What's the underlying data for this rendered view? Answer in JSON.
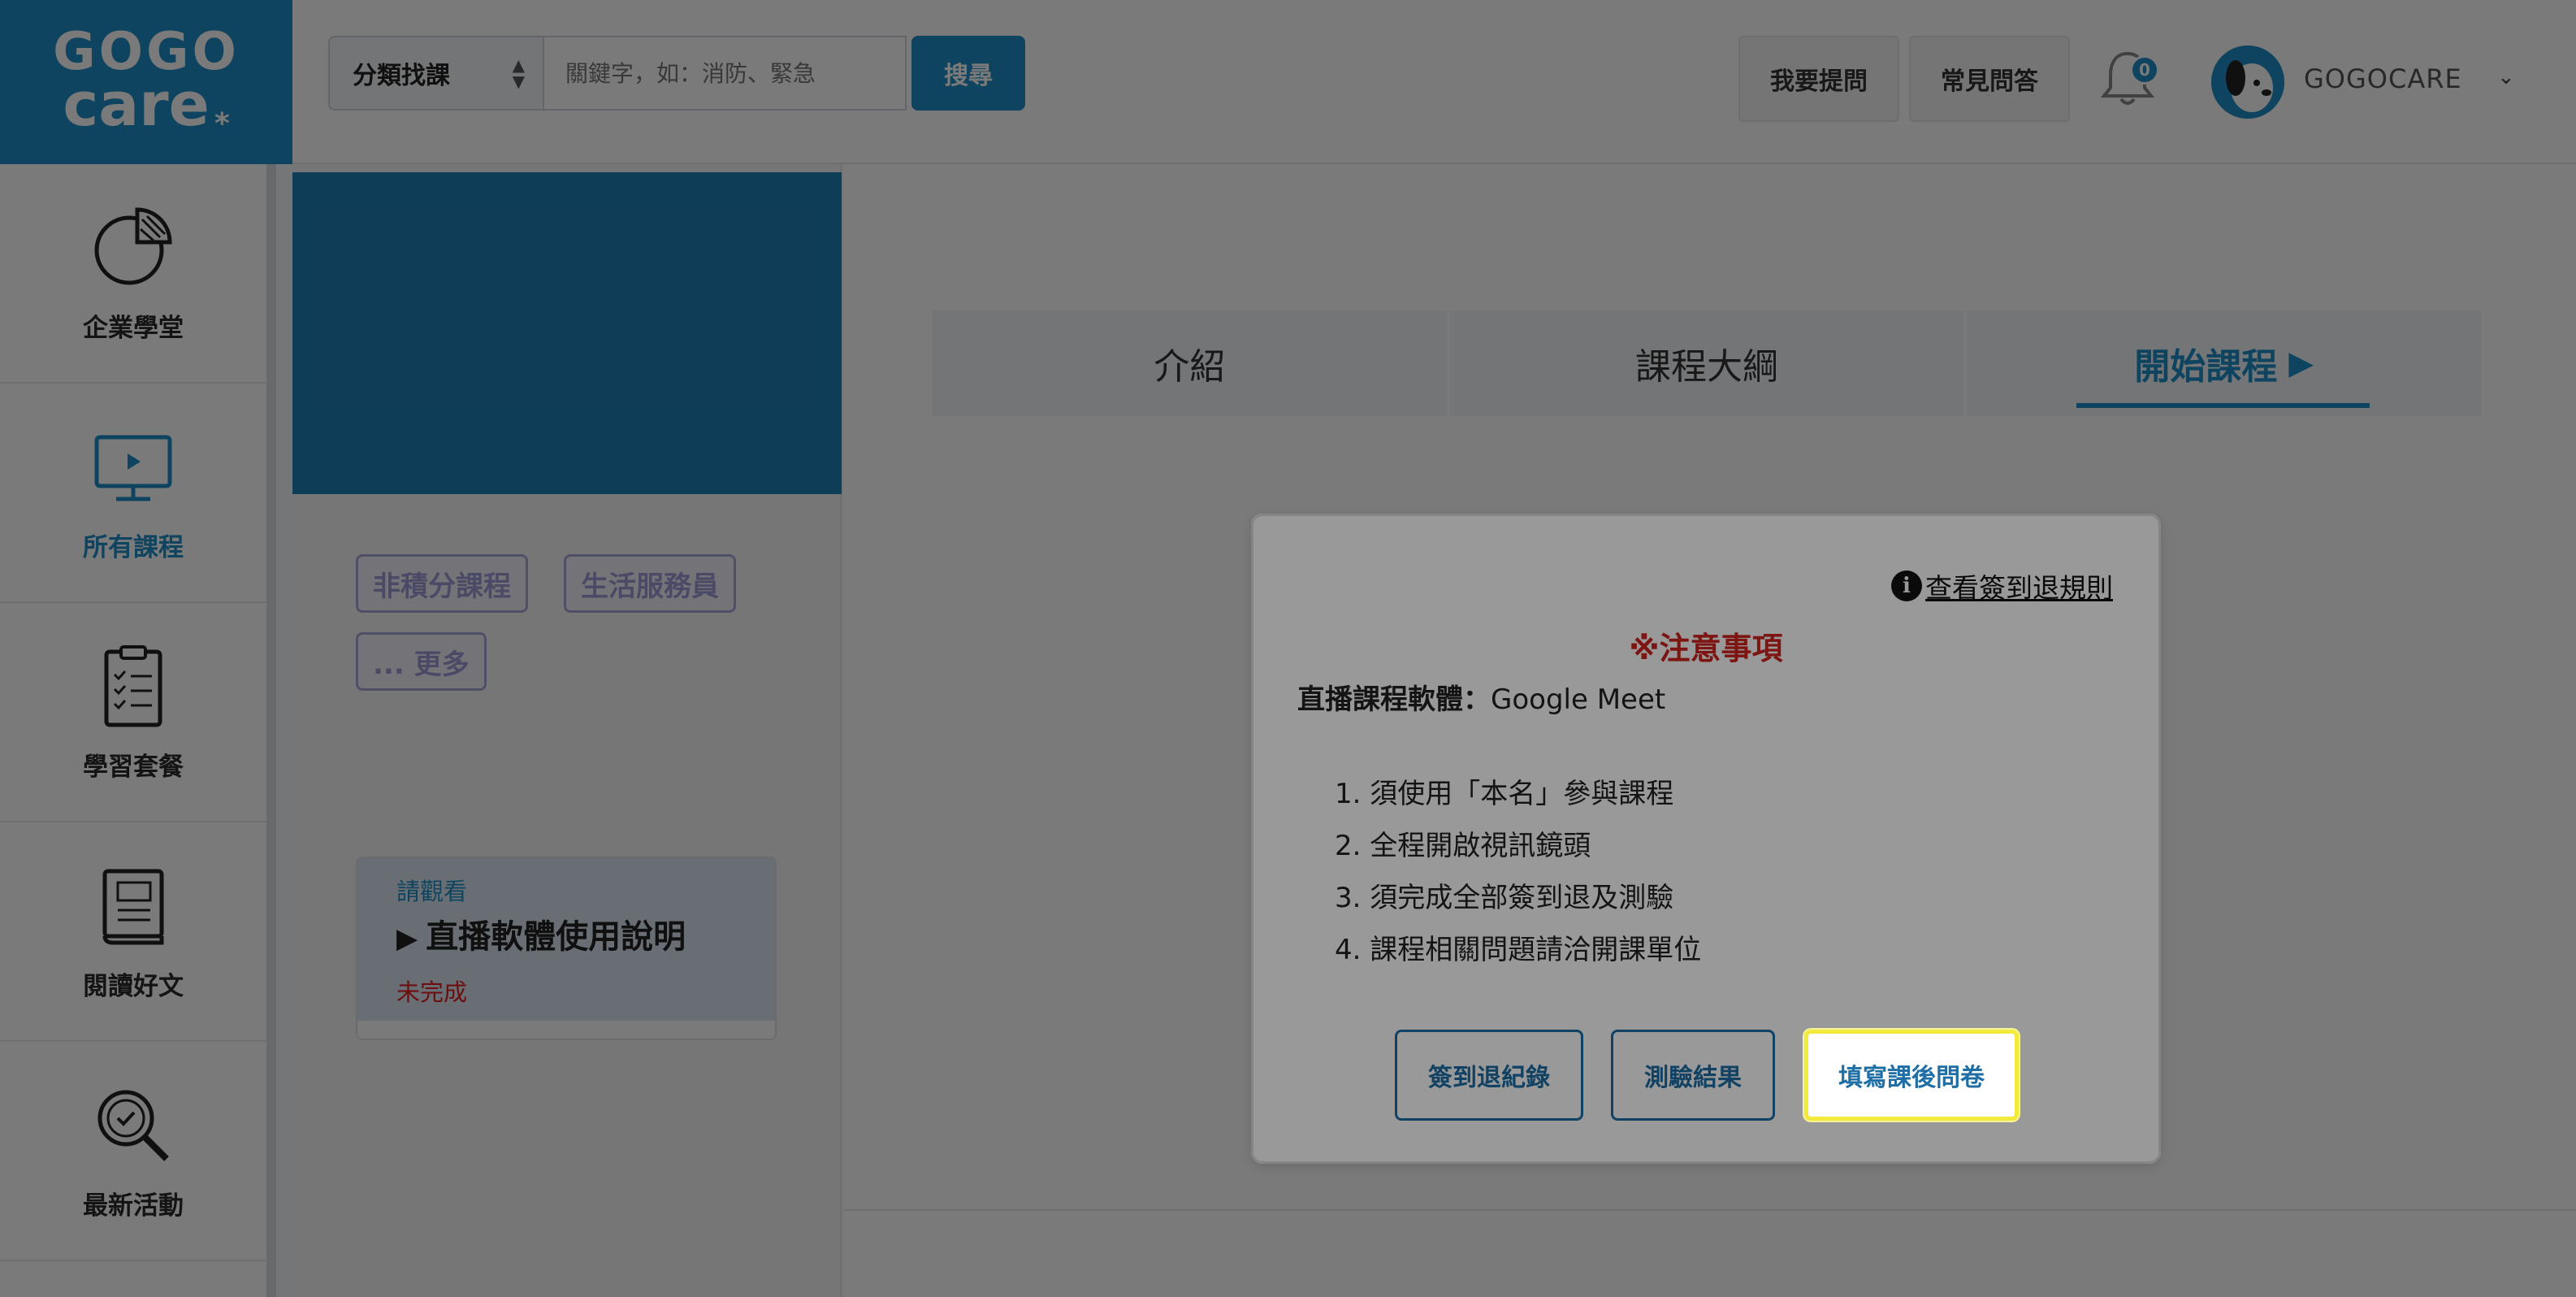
{
  "logo": {
    "line1": "GOGO",
    "line2": "care",
    "mark": "*"
  },
  "header": {
    "category_select": "分類找課",
    "search_placeholder": "關鍵字，如：消防、緊急",
    "search_button": "搜尋",
    "ask_button": "我要提問",
    "faq_button": "常見問答",
    "notification_count": "0",
    "username": "GOGOCARE"
  },
  "nav": {
    "items": [
      {
        "label": "企業學堂",
        "icon": "pie-chart-icon"
      },
      {
        "label": "所有課程",
        "icon": "monitor-icon",
        "active": true
      },
      {
        "label": "學習套餐",
        "icon": "checklist-icon"
      },
      {
        "label": "閱讀好文",
        "icon": "book-icon"
      },
      {
        "label": "最新活動",
        "icon": "search-check-icon"
      }
    ]
  },
  "course": {
    "tags": [
      "非積分課程",
      "生活服務員",
      "... 更多"
    ],
    "video": {
      "prompt": "請觀看",
      "title": "直播軟體使用說明",
      "status": "未完成"
    }
  },
  "tabs": [
    {
      "label": "介紹"
    },
    {
      "label": "課程大綱"
    },
    {
      "label": "開始課程",
      "active": true
    }
  ],
  "notice": {
    "rules_link": "查看簽到退規則",
    "title": "※注意事項",
    "software_label": "直播課程軟體：",
    "software_value": "Google Meet",
    "rules": [
      "1. 須使用「本名」參與課程",
      "2. 全程開啟視訊鏡頭",
      "3. 須完成全部簽到退及測驗",
      "4. 課程相關問題請洽開課單位"
    ],
    "buttons": {
      "checkin_records": "簽到退紀錄",
      "quiz_results": "測驗結果",
      "survey": "填寫課後問卷"
    }
  },
  "colors": {
    "brand": "#1f8ec7",
    "alert": "#d0231e",
    "highlight": "#f2ea3c",
    "tag": "#9b9bd6"
  }
}
